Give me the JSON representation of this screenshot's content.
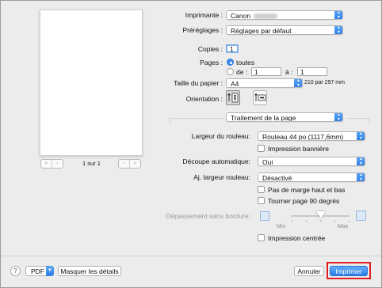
{
  "preview": {
    "page_counter": "1 sur 1"
  },
  "printer": {
    "label": "Imprimante :",
    "value": "Canon"
  },
  "presets": {
    "label": "Préréglages :",
    "value": "Réglages par défaut"
  },
  "copies": {
    "label": "Copies :",
    "value": "1"
  },
  "pages": {
    "label": "Pages :",
    "all_label": "toutes",
    "from_label": "de :",
    "from_value": "1",
    "to_label": "à :",
    "to_value": "1"
  },
  "paper_size": {
    "label": "Taille du papier :",
    "value": "A4",
    "dimensions": "210 par 297 mm"
  },
  "orientation": {
    "label": "Orientation :"
  },
  "section": {
    "value": "Traitement de la page"
  },
  "roll_width": {
    "label": "Largeur du rouleau:",
    "value": "Rouleau 44 po (1117,6mm)"
  },
  "banner": {
    "label": "Impression bannière"
  },
  "auto_cut": {
    "label": "Découpe automatique:",
    "value": "Oui"
  },
  "fit_roll": {
    "label": "Aj. largeur rouleau:",
    "value": "Désactivé"
  },
  "no_margin": {
    "label": "Pas de marge haut et bas"
  },
  "rotate": {
    "label": "Tourner page 90 degrés"
  },
  "overflow": {
    "label": "Dépassement sans bordure:",
    "min": "Min",
    "max": "Max",
    "level": 0.55
  },
  "centered": {
    "label": "Impression centrée"
  },
  "footer": {
    "help": "?",
    "pdf": "PDF",
    "hide_details": "Masquer les détails",
    "cancel": "Annuler",
    "print": "Imprimer"
  },
  "colors": {
    "accent": "#3f8cf0",
    "highlight_border": "#e02020"
  }
}
